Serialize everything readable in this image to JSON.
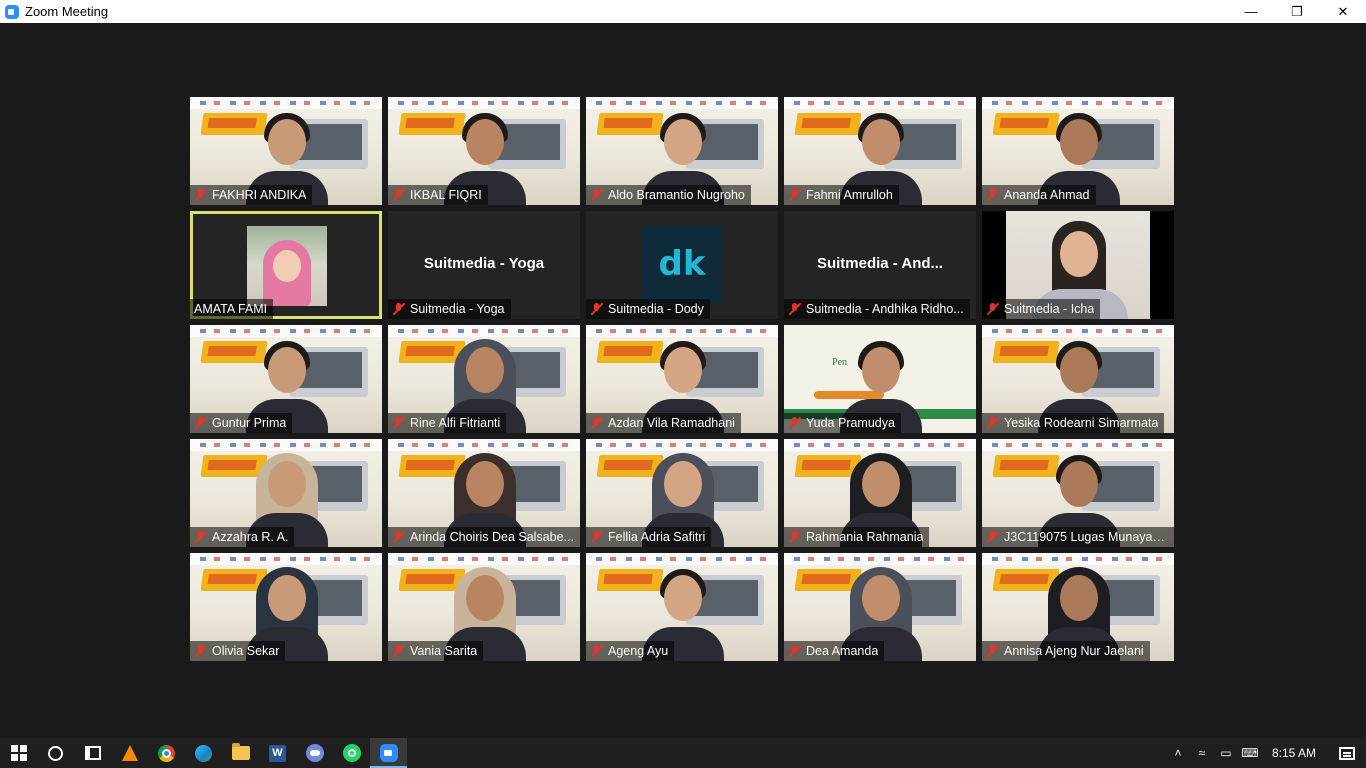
{
  "window": {
    "title": "Zoom Meeting",
    "min_glyph": "—",
    "restore_glyph": "❐",
    "close_glyph": "✕"
  },
  "participants": [
    {
      "name": "FAKHRI ANDIKA",
      "kind": "video"
    },
    {
      "name": "IKBAL FIQRI",
      "kind": "video"
    },
    {
      "name": "Aldo Bramantio Nugroho",
      "kind": "video"
    },
    {
      "name": "Fahmi Amrulloh",
      "kind": "video"
    },
    {
      "name": "Ananda Ahmad",
      "kind": "video"
    },
    {
      "name": "AMATA FAMI",
      "kind": "avatar",
      "muted": false,
      "active_speaker": true
    },
    {
      "name": "Suitmedia - Yoga",
      "kind": "label",
      "label": "Suitmedia - Yoga"
    },
    {
      "name": "Suitmedia - Dody",
      "kind": "logo",
      "logo_text": "dk"
    },
    {
      "name": "Suitmedia - Andhika Ridho...",
      "kind": "label",
      "label": "Suitmedia - And..."
    },
    {
      "name": "Suitmedia - Icha",
      "kind": "photo"
    },
    {
      "name": "Guntur Prima",
      "kind": "video"
    },
    {
      "name": "Rine Alfi Fitrianti",
      "kind": "video"
    },
    {
      "name": "Azdan Vila Ramadhani",
      "kind": "video"
    },
    {
      "name": "Yuda Pramudya",
      "kind": "video"
    },
    {
      "name": "Yesika Rodearni Simarmata",
      "kind": "video"
    },
    {
      "name": "Azzahra R. A.",
      "kind": "video"
    },
    {
      "name": "Arinda Choiris Dea Salsabe...",
      "kind": "video"
    },
    {
      "name": "Fellia Adria Safitri",
      "kind": "video"
    },
    {
      "name": "Rahmania Rahmania",
      "kind": "video"
    },
    {
      "name": "J3C119075 Lugas Munayas...",
      "kind": "video"
    },
    {
      "name": "Olivia Sekar",
      "kind": "video"
    },
    {
      "name": "Vania Sarita",
      "kind": "video"
    },
    {
      "name": "Ageng Ayu",
      "kind": "video"
    },
    {
      "name": "Dea Amanda",
      "kind": "video"
    },
    {
      "name": "Annisa Ajeng Nur Jaelani",
      "kind": "video"
    }
  ],
  "taskbar": {
    "word_letter": "W",
    "clock": "8:15 AM",
    "tray_up_glyph": "˄",
    "tray_wifi_glyph": "≈",
    "tray_battery_glyph": "▭",
    "tray_keyboard_glyph": "⌨"
  },
  "colors": {
    "meeting_bg": "#1a1a1a",
    "active_speaker": "#d9e36b",
    "mute_red": "#e0352b",
    "zoom_blue": "#2d8cff"
  }
}
